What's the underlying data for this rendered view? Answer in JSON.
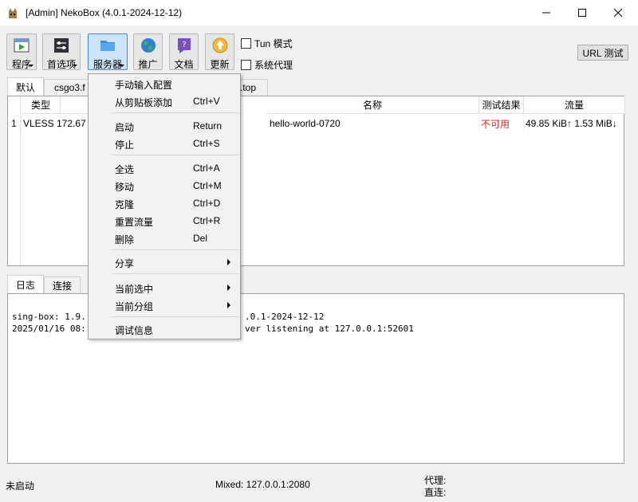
{
  "window": {
    "title": "[Admin] NekoBox (4.0.1-2024-12-12)"
  },
  "toolbar": {
    "buttons": [
      {
        "label": "程序",
        "icon": "program-icon"
      },
      {
        "label": "首选项",
        "icon": "preferences-icon"
      },
      {
        "label": "服务器",
        "icon": "server-folder-icon"
      },
      {
        "label": "推广",
        "icon": "globe-icon"
      },
      {
        "label": "文档",
        "icon": "document-question-icon"
      },
      {
        "label": "更新",
        "icon": "update-icon"
      }
    ],
    "tun_label": "Tun 模式",
    "system_proxy_label": "系统代理",
    "url_test_label": "URL 测试"
  },
  "group_tabs": {
    "tab0": "默认",
    "tab1": "csgo3.f",
    "tab2_tail": ".top"
  },
  "table": {
    "headers": {
      "type": "类型",
      "name": "名称",
      "test": "测试结果",
      "traffic": "流量"
    },
    "row": {
      "index": "1",
      "type": "VLESS",
      "address": "172.67",
      "name": "hello-world-0720",
      "test": "不可用",
      "traffic": "49.85 KiB↑ 1.53 MiB↓"
    }
  },
  "log_tabs": {
    "log": "日志",
    "conn": "连接"
  },
  "log": {
    "line1_left": "sing-box: 1.9.",
    "line1_right": ".0.1-2024-12-12",
    "line2_left": "2025/01/16 08:",
    "line2_right": "ver listening at 127.0.0.1:52601"
  },
  "statusbar": {
    "state": "未启动",
    "mixed": "Mixed: 127.0.0.1:2080",
    "proxy": "代理:",
    "direct": "直连:"
  },
  "menu": {
    "manual": "手动输入配置",
    "clipboard": "从剪贴板添加",
    "clipboard_sc": "Ctrl+V",
    "start": "启动",
    "start_sc": "Return",
    "stop": "停止",
    "stop_sc": "Ctrl+S",
    "select_all": "全选",
    "select_all_sc": "Ctrl+A",
    "move": "移动",
    "move_sc": "Ctrl+M",
    "clone": "克隆",
    "clone_sc": "Ctrl+D",
    "reset": "重置流量",
    "reset_sc": "Ctrl+R",
    "delete": "删除",
    "delete_sc": "Del",
    "share": "分享",
    "current_sel": "当前选中",
    "current_group": "当前分组",
    "debug": "调试信息"
  },
  "colors": {
    "unavailable": "#e02020",
    "menu_bg": "#f2f2f2",
    "active_btn": "#cce4f7"
  }
}
